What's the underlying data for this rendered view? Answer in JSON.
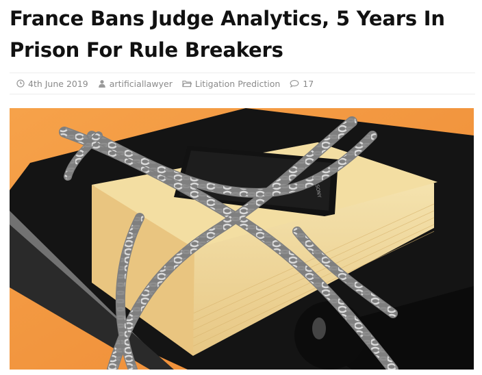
{
  "article": {
    "title": "France Bans Judge Analytics, 5 Years In Prison For Rule Breakers",
    "meta": {
      "date": "4th June 2019",
      "author": "artificiallawyer",
      "category": "Litigation Prediction",
      "comments": "17"
    },
    "icons": {
      "date": "clock-icon",
      "author": "user-icon",
      "category": "folder-icon",
      "comments": "comment-icon"
    },
    "image": {
      "phone_brand": "SONY"
    }
  },
  "colors": {
    "background_orange": "#f0923a",
    "book_page": "#f4dfa6",
    "chain": "#c8c8c8",
    "meta_text": "#8a8a8a",
    "headline": "#111111"
  }
}
